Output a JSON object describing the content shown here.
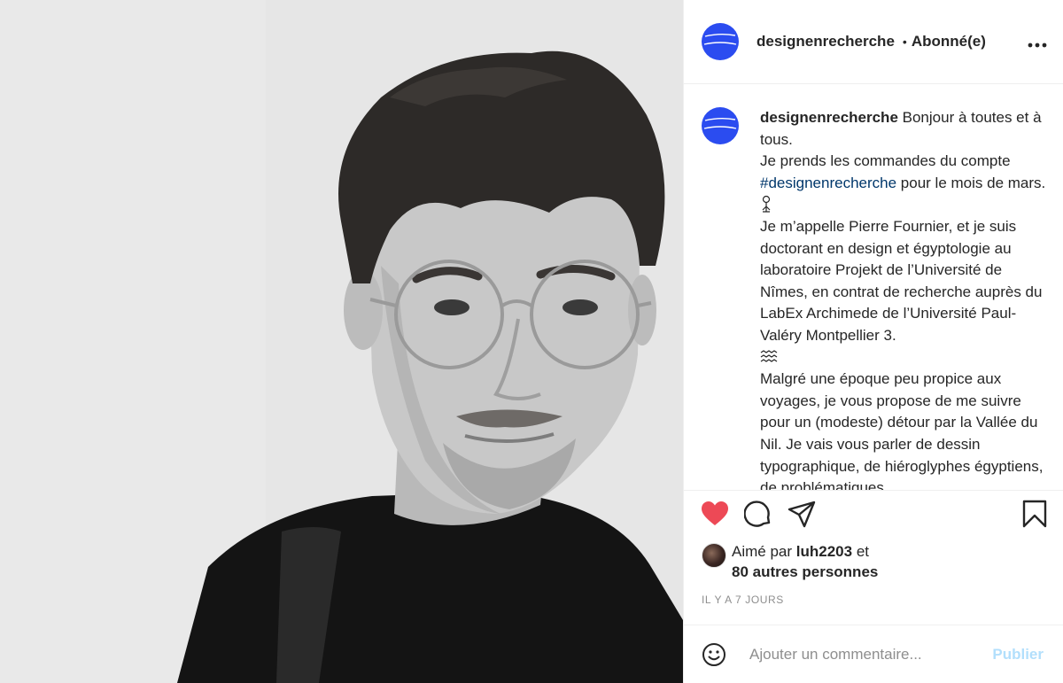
{
  "post": {
    "username": "designenrecherche",
    "follow_status": "Abonné(e)",
    "separator": "•",
    "more_label": "•••"
  },
  "caption": {
    "username": "designenrecherche",
    "line_1": "Bonjour à toutes et à tous.",
    "line_2a": "Je prends les commandes du compte",
    "hashtag": "#designenrecherche",
    "line_2b": "pour le mois de mars.",
    "paragraph_2": "Je m’appelle Pierre Fournier, et je suis doctorant en design et égyptologie au laboratoire Projekt de l’Université de Nîmes, en contrat de recherche auprès du LabEx Archimede de l’Université Paul-Valéry Montpellier 3.",
    "paragraph_3": "Malgré une époque peu propice aux voyages, je vous propose de me suivre pour un (modeste) détour par la Vallée du Nil. Je vais vous parler de dessin typographique, de hiéroglyphes égyptiens, de problématiques"
  },
  "likes": {
    "prefix": "Aimé par",
    "user": "luh2203",
    "joiner": "et",
    "others": "80 autres personnes"
  },
  "timestamp": "IL Y A 7 JOURS",
  "comment": {
    "placeholder": "Ajouter un commentaire...",
    "publish_label": "Publier"
  },
  "colors": {
    "brand_avatar": "#2b4cf0",
    "like_red": "#ed4956",
    "hashtag": "#00376b",
    "publish_disabled": "#b2dffc"
  },
  "icons": [
    "heart-icon",
    "comment-icon",
    "share-icon",
    "bookmark-icon",
    "emoji-icon",
    "more-icon"
  ],
  "like_state": "liked"
}
